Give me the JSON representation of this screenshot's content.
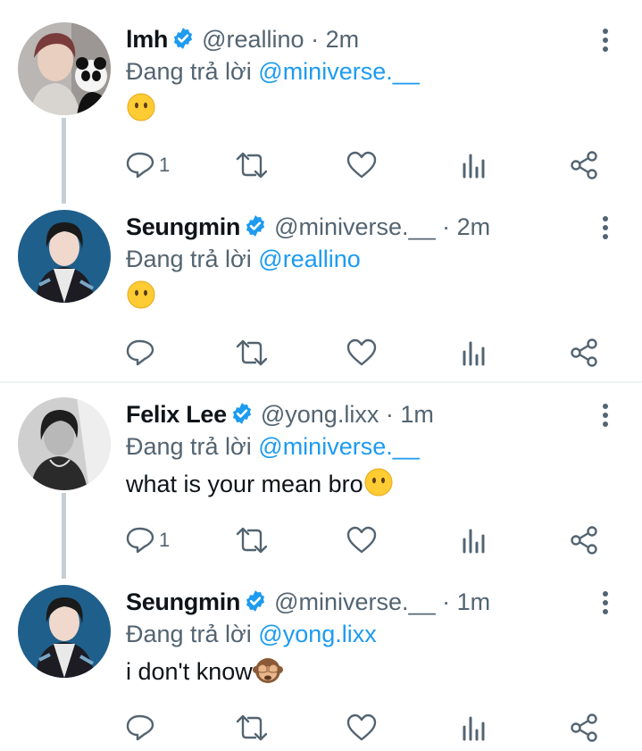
{
  "reply_prefix": "Đang trả lời",
  "colors": {
    "accent": "#1d9bf0",
    "muted": "#536471",
    "text": "#0f1419"
  },
  "tweets": [
    {
      "name": "lmh",
      "handle": "@reallino",
      "dot": "·",
      "time": "2m",
      "reply_to": "@miniverse.__",
      "text": "",
      "emoji": "neutral-face",
      "reply_count": "1"
    },
    {
      "name": "Seungmin",
      "handle": "@miniverse.__",
      "dot": "·",
      "time": "2m",
      "reply_to": "@reallino",
      "text": "",
      "emoji": "neutral-face",
      "reply_count": ""
    },
    {
      "name": "Felix Lee",
      "handle": "@yong.lixx",
      "dot": "·",
      "time": "1m",
      "reply_to": "@miniverse.__",
      "text": "what is your mean bro",
      "emoji": "neutral-face",
      "reply_count": "1"
    },
    {
      "name": "Seungmin",
      "handle": "@miniverse.__",
      "dot": "·",
      "time": "1m",
      "reply_to": "@yong.lixx",
      "text": "i don't know",
      "emoji": "see-no-evil-monkey",
      "reply_count": ""
    }
  ]
}
